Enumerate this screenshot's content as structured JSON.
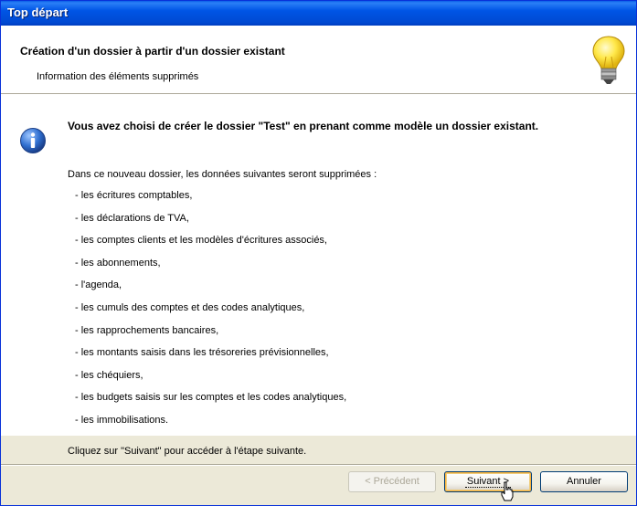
{
  "window": {
    "title": "Top départ"
  },
  "header": {
    "title": "Création d'un dossier à partir d'un dossier existant",
    "subtitle": "Information des éléments supprimés",
    "icon": "lightbulb-icon"
  },
  "content": {
    "icon": "info-icon",
    "headline": "Vous avez choisi de créer le dossier \"Test\" en prenant comme modèle un dossier existant.",
    "intro": "Dans ce nouveau dossier, les données suivantes seront supprimées :",
    "items": [
      "- les écritures comptables,",
      "- les déclarations de TVA,",
      "- les comptes clients et les modèles d'écritures associés,",
      "- les abonnements,",
      "- l'agenda,",
      "- les cumuls des comptes et des codes analytiques,",
      "- les rapprochements bancaires,",
      "- les montants saisis dans les trésoreries prévisionnelles,",
      "- les chéquiers,",
      "- les budgets saisis sur les comptes et les codes analytiques,",
      "- les immobilisations."
    ],
    "outro": "Cliquez sur \"Suivant\" pour accéder à l'étape suivante."
  },
  "buttons": {
    "previous": "< Précédent",
    "next": "Suivant >",
    "cancel": "Annuler"
  },
  "colors": {
    "titlebar": "#0055e5",
    "window_bg": "#ece9d8",
    "panel_bg": "#ffffff",
    "info_icon": "#2f6fd0",
    "bulb": "#ffe84a"
  }
}
